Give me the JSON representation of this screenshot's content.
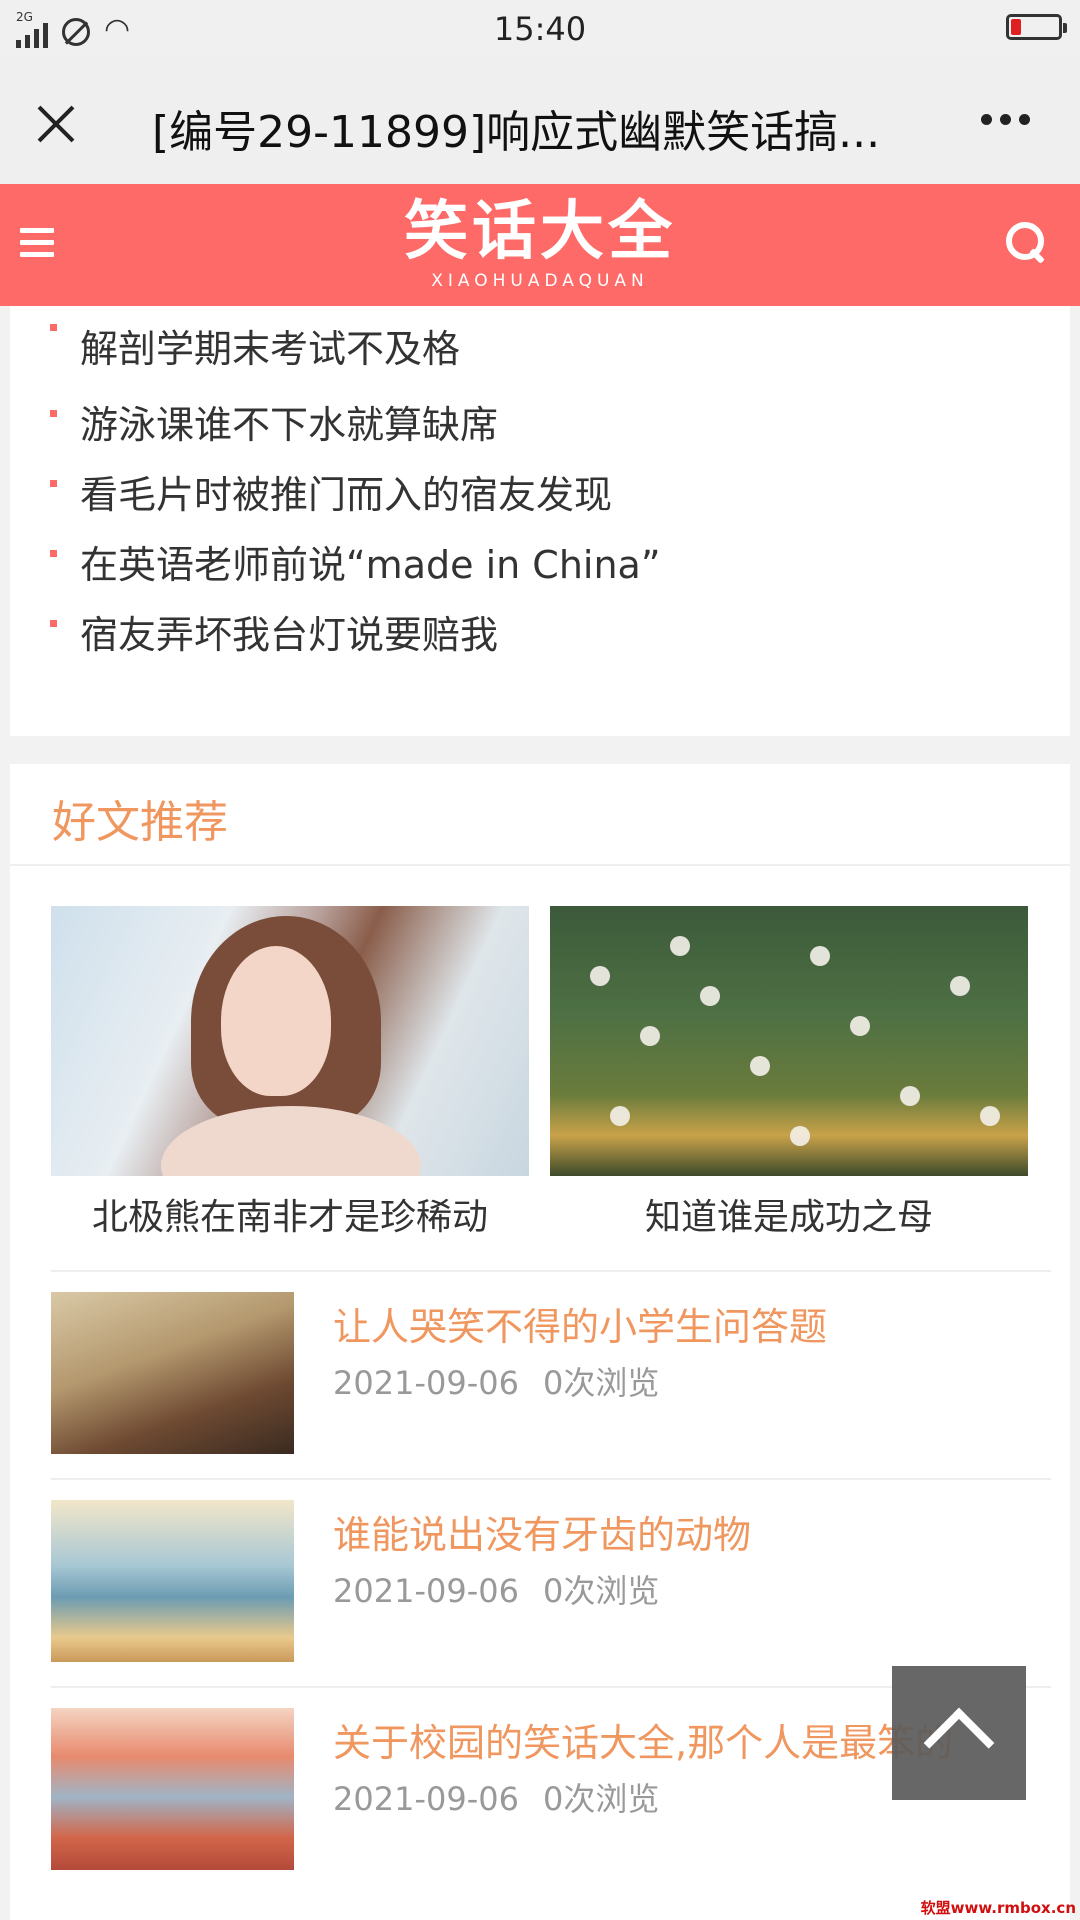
{
  "status_bar": {
    "network": "2G",
    "time": "15:40",
    "battery_color": "#e02020"
  },
  "title_bar": {
    "title": "[编号29-11899]响应式幽默笑话搞..."
  },
  "header": {
    "logo_cn": "笑话大全",
    "logo_en": "XIAOHUADAQUAN",
    "accent": "#fd6a67"
  },
  "joke_list": [
    "解剖学期末考试不及格",
    "游泳课谁不下水就算缺席",
    "看毛片时被推门而入的宿友发现",
    "在英语老师前说“made in China”",
    "宿友弄坏我台灯说要赔我"
  ],
  "recommend": {
    "heading": "好文推荐",
    "featured": [
      {
        "caption": "北极熊在南非才是珍稀动"
      },
      {
        "caption": "知道谁是成功之母"
      }
    ],
    "items": [
      {
        "title": "让人哭笑不得的小学生问答题",
        "date": "2021-09-06",
        "views": "0次浏览"
      },
      {
        "title": "谁能说出没有牙齿的动物",
        "date": "2021-09-06",
        "views": "0次浏览"
      },
      {
        "title": "关于校园的笑话大全,那个人是最笨的",
        "date": "2021-09-06",
        "views": "0次浏览"
      }
    ],
    "title_color": "#f0965f"
  },
  "watermark": "软盟www.rmbox.cn"
}
